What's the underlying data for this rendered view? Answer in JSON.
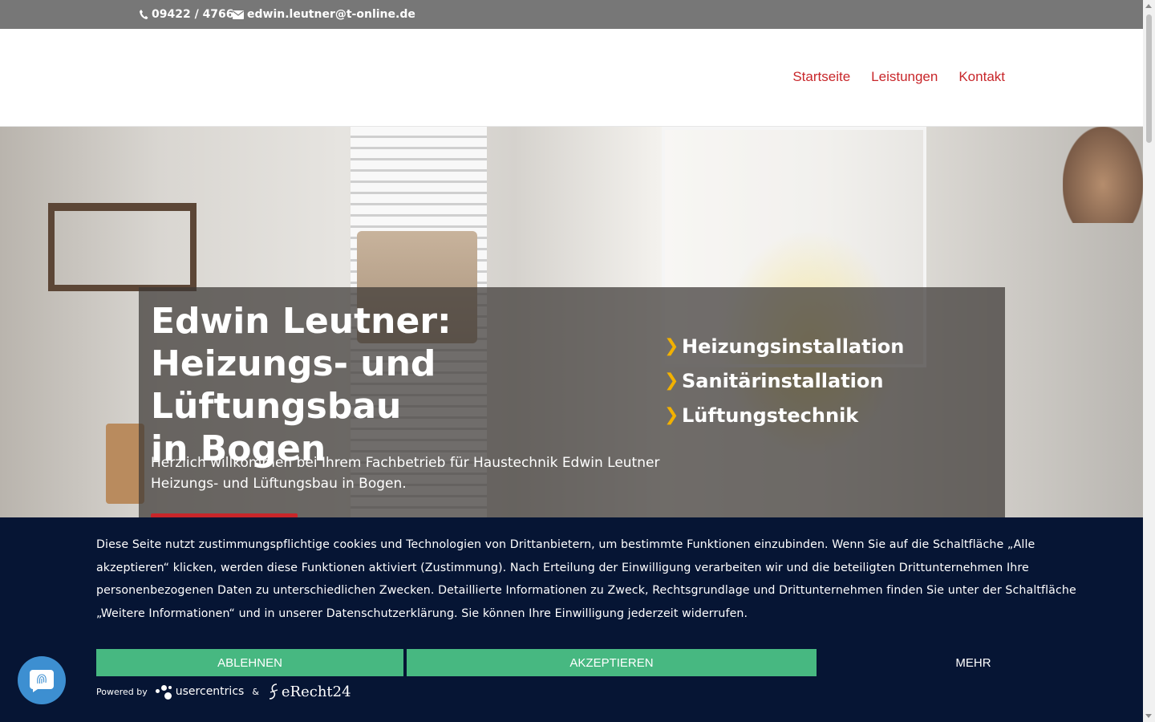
{
  "topbar": {
    "phone_icon": "phone-icon",
    "phone": "09422 / 4766",
    "email_icon": "envelope-icon",
    "email": "edwin.leutner@t-online.de"
  },
  "nav": {
    "items": [
      {
        "label": "Startseite"
      },
      {
        "label": "Leistungen"
      },
      {
        "label": "Kontakt"
      }
    ],
    "color": "#c8262a"
  },
  "hero": {
    "title_line1": "Edwin Leutner:",
    "title_line2": "Heizungs- und Lüftungsbau",
    "title_line3": "in Bogen",
    "text_line1": "Herzlich willkommen bei Ihrem Fachbetrieb für Haustechnik Edwin Leutner",
    "text_line2": "Heizungs- und Lüftungsbau in Bogen.",
    "services": [
      {
        "label": "Heizungsinstallation"
      },
      {
        "label": "Sanitärinstallation"
      },
      {
        "label": "Lüftungstechnik"
      }
    ],
    "bullet_icon": "chevron-right-icon",
    "bullet_color": "#f2b100"
  },
  "cookie": {
    "text": "Diese Seite nutzt zustimmungspflichtige cookies und Technologien von Drittanbietern, um bestimmte Funktionen einzubinden. Wenn Sie auf die Schaltfläche „Alle akzeptieren“ klicken, werden diese Funktionen aktiviert (Zustimmung). Nach Erteilung der Einwilligung verarbeiten wir und die beteiligten Drittunternehmen Ihre personenbezogenen Daten zu unterschiedlichen Zwecken. Detaillierte Informationen zu Zweck, Rechtsgrundlage und Drittunternehmen finden Sie unter der Schaltfläche „Weitere Informationen“ und in unserer Datenschutzerklärung. Sie können Ihre Einwilligung jederzeit widerrufen.",
    "deny_label": "ABLEHNEN",
    "accept_label": "AKZEPTIEREN",
    "more_label": "MEHR",
    "powered_by": "Powered by",
    "usercentrics": "usercentrics",
    "ampersand": "&",
    "erecht": "eRecht24",
    "button_color": "#47b881",
    "background": "#061534"
  },
  "privacy_button": {
    "icon": "fingerprint-icon"
  }
}
